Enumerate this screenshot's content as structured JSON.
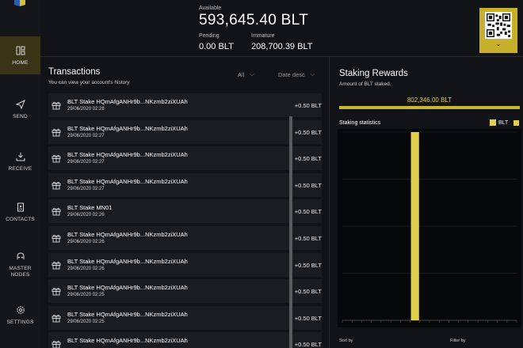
{
  "sidebar": {
    "items": [
      {
        "label": "HOME",
        "icon": "home-icon",
        "active": true
      },
      {
        "label": "SEND",
        "icon": "send-icon",
        "active": false
      },
      {
        "label": "RECEIVE",
        "icon": "receive-icon",
        "active": false
      },
      {
        "label": "CONTACTS",
        "icon": "contacts-icon",
        "active": false
      },
      {
        "label": "MASTER NODES",
        "icon": "masternodes-icon",
        "active": false
      },
      {
        "label": "SETTINGS",
        "icon": "settings-icon",
        "active": false
      }
    ]
  },
  "header": {
    "available_label": "Available",
    "available": "593,645.40 BLT",
    "pending_label": "Pending",
    "pending": "0.00 BLT",
    "immature_label": "Immature",
    "immature": "208,700.39 BLT"
  },
  "transactions": {
    "title": "Transactions",
    "subtitle": "You can view your account's history",
    "filter": "All",
    "sort": "Date desc",
    "rows": [
      {
        "desc": "BLT Stake HQmAfgANHr9b...NKzmb2ziXUAh",
        "date": "29/06/2020 02:28",
        "amount": "+0.50 BLT"
      },
      {
        "desc": "BLT Stake HQmAfgANHr9b...NKzmb2ziXUAh",
        "date": "29/06/2020 02:27",
        "amount": "+0.50 BLT"
      },
      {
        "desc": "BLT Stake HQmAfgANHr9b...NKzmb2ziXUAh",
        "date": "29/06/2020 02:27",
        "amount": "+0.50 BLT"
      },
      {
        "desc": "BLT Stake HQmAfgANHr9b...NKzmb2ziXUAh",
        "date": "29/06/2020 02:27",
        "amount": "+0.50 BLT"
      },
      {
        "desc": "BLT Stake MN01",
        "date": "29/06/2020 02:26",
        "amount": "+0.50 BLT"
      },
      {
        "desc": "BLT Stake HQmAfgANHr9b...NKzmb2ziXUAh",
        "date": "29/06/2020 02:26",
        "amount": "+0.50 BLT"
      },
      {
        "desc": "BLT Stake HQmAfgANHr9b...NKzmb2ziXUAh",
        "date": "29/06/2020 02:26",
        "amount": "+0.50 BLT"
      },
      {
        "desc": "BLT Stake HQmAfgANHr9b...NKzmb2ziXUAh",
        "date": "29/06/2020 02:25",
        "amount": "+0.50 BLT"
      },
      {
        "desc": "BLT Stake HQmAfgANHr9b...NKzmb2ziXUAh",
        "date": "29/06/2020 02:25",
        "amount": "+0.50 BLT"
      },
      {
        "desc": "BLT Stake HQmAfgANHr9b...NKzmb2ziXUAh",
        "date": "",
        "amount": "+0.50 BLT"
      }
    ]
  },
  "staking": {
    "title": "Staking Rewards",
    "subtitle": "Amount of BLT staked.",
    "amount": "802,346.00 BLT",
    "stats_label": "Staking statistics",
    "legend_name": "BLT",
    "sort_label": "Sort by",
    "filter_label": "Filter by"
  },
  "colors": {
    "accent": "#d4c03a",
    "bar": "#e3d04a",
    "background": "#111316"
  },
  "chart_data": {
    "type": "bar",
    "series": [
      {
        "name": "BLT",
        "values": [
          0,
          0,
          0,
          0,
          0,
          0,
          0,
          802346,
          0,
          0,
          0,
          0,
          0,
          0,
          0,
          0,
          0,
          0
        ]
      }
    ],
    "ylim": [
      0,
      802346
    ],
    "grid": true,
    "legend": "top-right"
  }
}
